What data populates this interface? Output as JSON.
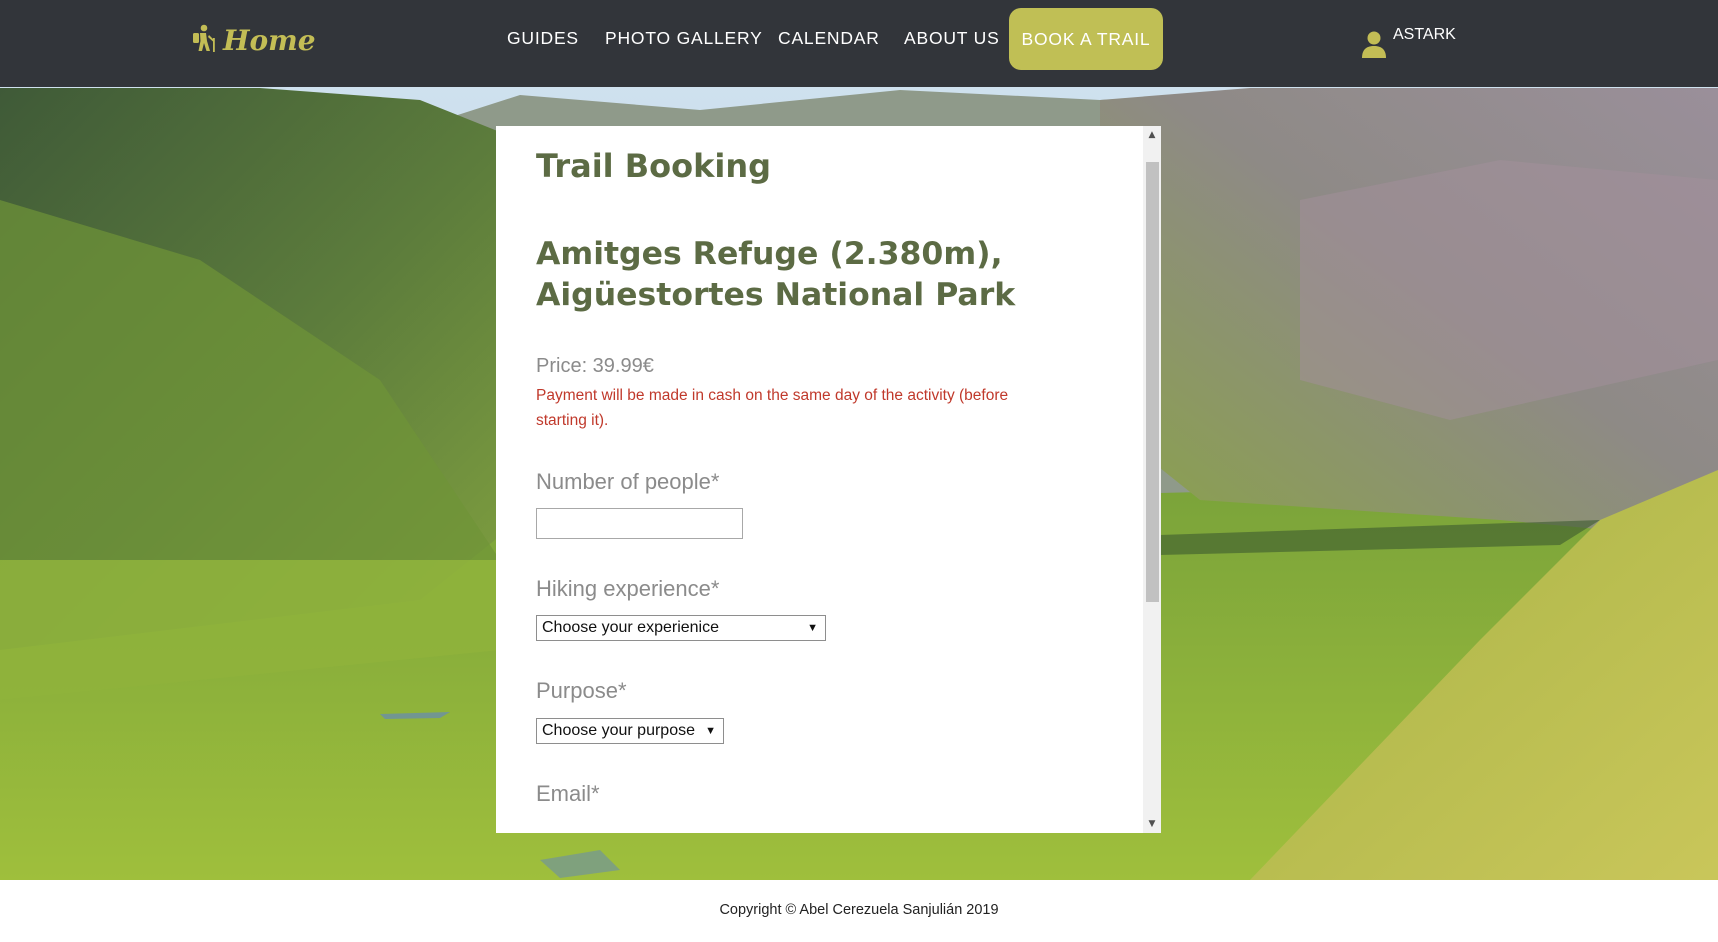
{
  "nav": {
    "brand_label": "Home",
    "brand_icon": "hiker-icon",
    "links": [
      "GUIDES",
      "PHOTO GALLERY",
      "CALENDAR",
      "ABOUT US"
    ],
    "cta_label": "BOOK A TRAIL",
    "user_name": "ASTARK",
    "user_icon": "user-icon"
  },
  "booking": {
    "title": "Trail Booking",
    "trail_name": "Amitges Refuge (2.380m), Aigüestortes National Park",
    "price": "Price: 39.99€",
    "payment_note": "Payment will be made in cash on the same day of the activity (before starting it).",
    "fields": {
      "people_label": "Number of people*",
      "people_value": "",
      "experience_label": "Hiking experience*",
      "experience_selected": "Choose your experienice",
      "purpose_label": "Purpose*",
      "purpose_selected": "Choose your purpose",
      "email_label": "Email*"
    }
  },
  "footer": {
    "copyright": "Copyright © Abel Cerezuela Sanjulián 2019"
  },
  "colors": {
    "nav_bg": "#26282c",
    "accent": "#c0bf55",
    "heading": "#5c6b44",
    "note_red": "#c0392b"
  }
}
